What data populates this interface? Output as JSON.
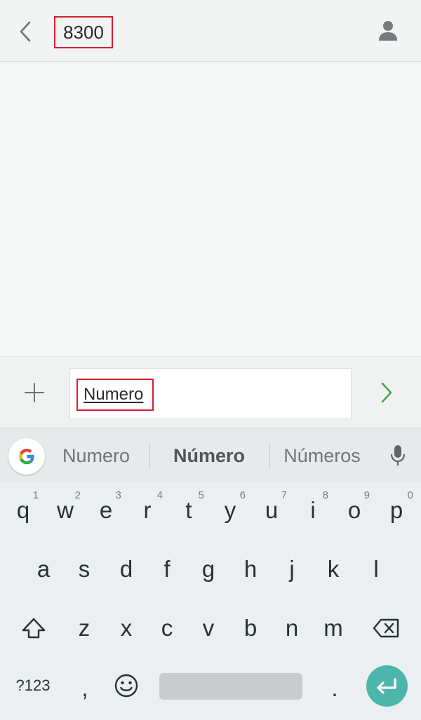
{
  "header": {
    "title": "8300",
    "back_icon": "chevron-left-icon",
    "contact_icon": "person-icon"
  },
  "compose": {
    "attach_icon": "plus-icon",
    "message_text": "Numero",
    "send_icon": "chevron-right-icon"
  },
  "suggestions": {
    "items": [
      "Numero",
      "Número",
      "Números"
    ],
    "logo": "google-g-icon",
    "mic_icon": "microphone-icon"
  },
  "keyboard": {
    "row1": [
      {
        "label": "q",
        "hint": "1"
      },
      {
        "label": "w",
        "hint": "2"
      },
      {
        "label": "e",
        "hint": "3"
      },
      {
        "label": "r",
        "hint": "4"
      },
      {
        "label": "t",
        "hint": "5"
      },
      {
        "label": "y",
        "hint": "6"
      },
      {
        "label": "u",
        "hint": "7"
      },
      {
        "label": "i",
        "hint": "8"
      },
      {
        "label": "o",
        "hint": "9"
      },
      {
        "label": "p",
        "hint": "0"
      }
    ],
    "row2": [
      "a",
      "s",
      "d",
      "f",
      "g",
      "h",
      "j",
      "k",
      "l"
    ],
    "row3": [
      "z",
      "x",
      "c",
      "v",
      "b",
      "n",
      "m"
    ],
    "symbols_label": "?123",
    "comma_label": ",",
    "period_label": ".",
    "shift_icon": "shift-icon",
    "backspace_icon": "backspace-icon",
    "emoji_icon": "emoji-icon",
    "enter_icon": "enter-icon"
  },
  "colors": {
    "highlight": "#d6202c",
    "send_accent": "#43a047",
    "enter_key": "#4db6ac",
    "text_dark": "#263238"
  }
}
